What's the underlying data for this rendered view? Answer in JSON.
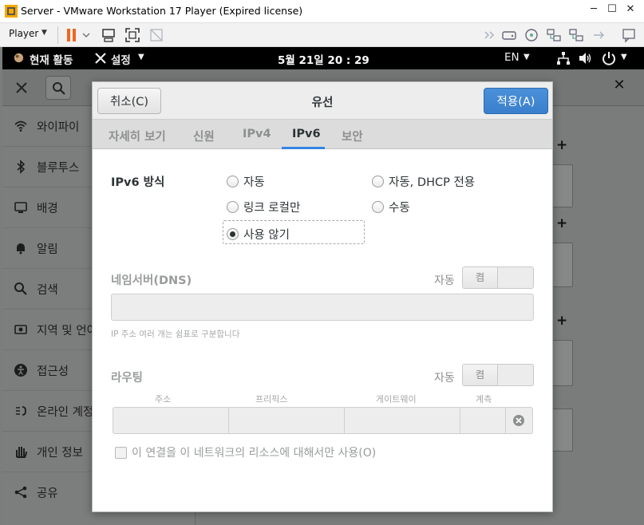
{
  "window": {
    "title": "Server - VMware Workstation 17 Player (Expired license)",
    "minimize": "─",
    "maximize": "☐",
    "close": "✕"
  },
  "vm_toolbar": {
    "player_label": "Player",
    "player_caret": "▼"
  },
  "gnome_topbar": {
    "activities": "현재 활동",
    "app_menu": "설정",
    "clock": "5월 21일  20 : 29",
    "language": "EN"
  },
  "settings_app": {
    "sidebar_items": [
      {
        "label": "와이파이",
        "icon": "wifi-icon"
      },
      {
        "label": "블루투스",
        "icon": "bluetooth-icon"
      },
      {
        "label": "배경",
        "icon": "background-icon"
      },
      {
        "label": "알림",
        "icon": "bell-icon"
      },
      {
        "label": "검색",
        "icon": "search-icon"
      },
      {
        "label": "지역 및 언어",
        "icon": "region-icon"
      },
      {
        "label": "접근성",
        "icon": "accessibility-icon"
      },
      {
        "label": "온라인 계정",
        "icon": "online-accounts-icon"
      },
      {
        "label": "개인 정보",
        "icon": "privacy-icon"
      },
      {
        "label": "공유",
        "icon": "share-icon"
      }
    ],
    "plus_glyph": "+",
    "close_glyph": "✕"
  },
  "dialog": {
    "cancel_label": "취소(C)",
    "title": "유선",
    "apply_label": "적용(A)",
    "tabs": [
      {
        "label": "자세히 보기",
        "active": false
      },
      {
        "label": "신원",
        "active": false
      },
      {
        "label": "IPv4",
        "active": false
      },
      {
        "label": "IPv6",
        "active": true
      },
      {
        "label": "보안",
        "active": false
      }
    ],
    "ipv6_method": {
      "label": "IPv6 방식",
      "options": [
        {
          "label": "자동",
          "checked": false
        },
        {
          "label": "자동, DHCP 전용",
          "checked": false
        },
        {
          "label": "링크 로컬만",
          "checked": false
        },
        {
          "label": "수동",
          "checked": false
        },
        {
          "label": "사용 않기",
          "checked": true
        }
      ]
    },
    "dns": {
      "label": "네임서버(DNS)",
      "auto_label": "자동",
      "toggle_on": "켬",
      "value": "",
      "hint": "IP 주소 여러 개는 쉼표로 구분합니다"
    },
    "routing": {
      "label": "라우팅",
      "auto_label": "자동",
      "toggle_on": "켬",
      "columns": [
        "주소",
        "프리픽스",
        "게이트웨이",
        "계측"
      ]
    },
    "restrict_checkbox": {
      "label": "이 연결을 이 네트워크의 리소스에 대해서만 사용(O)",
      "checked": false
    }
  },
  "colors": {
    "accent": "#3584e4",
    "apply_button": "#3a7fcb",
    "dim_text": "#9a9c9c"
  }
}
